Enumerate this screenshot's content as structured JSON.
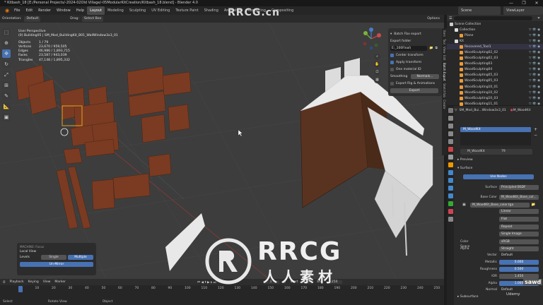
{
  "window": {
    "title": "* Kitbash_18 [E:/Personal Projects/-2024-02Old Village/-05ModularKitCreation/Kitbash_18.blend] - Blender 4.0",
    "controls": [
      "—",
      "❐",
      "✕"
    ]
  },
  "menubar": {
    "items": [
      "File",
      "Edit",
      "Render",
      "Window",
      "Help"
    ],
    "workspaces": [
      "Layout",
      "Modeling",
      "Sculpting",
      "UV Editing",
      "Texture Paint",
      "Shading",
      "Animation",
      "Rendering",
      "Compositing"
    ],
    "active_workspace": "Layout",
    "scene_label": "Scene",
    "viewlayer_label": "ViewLayer"
  },
  "header": {
    "orientation_label": "Orientation:",
    "orientation_value": "Default",
    "mode": "Object Mode",
    "menus": [
      "View",
      "Select",
      "Add",
      "Object"
    ],
    "transform_orientation": "Global",
    "drag_label": "Drag:",
    "drag_value": "Select Box",
    "options": "Options"
  },
  "stats": {
    "view": "User Perspective",
    "context": "(0) Building05 | SM_Mod_BuildingKit_B01_WallWindow3x3_01",
    "rows": [
      {
        "k": "Objects",
        "v": "1 / 79"
      },
      {
        "k": "Vertices",
        "v": "23,670 / 959,505"
      },
      {
        "k": "Edges",
        "v": "46,986 / 1,893,715"
      },
      {
        "k": "Faces",
        "v": "23,587 / 943,039"
      },
      {
        "k": "Triangles",
        "v": "47,148 / 1,895,332"
      }
    ]
  },
  "npanel": {
    "title": "Batch Fbx export",
    "folder_label": "Export folder",
    "folder_value": "E:_100Final\\",
    "center_transform": "Center transform",
    "apply_transform": "Apply transform",
    "one_material": "One material ID",
    "smoothing_label": "Smoothing",
    "smoothing_value": "Normals...",
    "export_rig": "Export Rig & Animations",
    "export_button": "Export",
    "tabs": [
      "Item",
      "Tool",
      "View",
      "Edit",
      "Batch Export",
      "Sketchfab",
      "Create"
    ]
  },
  "popup": {
    "title": "MACHIN3: Focus",
    "mode": "Local View",
    "levels_label": "Levels",
    "single": "Single",
    "multiple": "Multiple",
    "unmirror": "Un-Mirror"
  },
  "timeline": {
    "menus": [
      "Playback",
      "Keying",
      "View",
      "Marker"
    ],
    "current_frame": "1",
    "start_label": "Start",
    "start_value": "1",
    "end_label": "End",
    "end_value": "250",
    "ticks": [
      "0",
      "10",
      "20",
      "30",
      "40",
      "50",
      "60",
      "70",
      "80",
      "90",
      "100",
      "110",
      "120",
      "130",
      "140",
      "150",
      "160",
      "170",
      "180",
      "190",
      "200",
      "210",
      "220",
      "230",
      "240",
      "250"
    ],
    "status_select": "Select",
    "status_rotate": "Rotate View",
    "status_object": "Object"
  },
  "outliner": {
    "search_placeholder": "",
    "rows": [
      {
        "name": "Scene Collection",
        "indent": 0
      },
      {
        "name": "Collection",
        "indent": 1
      },
      {
        "name": "Plane",
        "indent": 2
      },
      {
        "name": "Kit",
        "indent": 1
      },
      {
        "name": "Recovered_Tool1",
        "indent": 2
      },
      {
        "name": "WoodSculpting02_02",
        "indent": 2
      },
      {
        "name": "WoodSculpting02_03",
        "indent": 2
      },
      {
        "name": "WoodSculpting03",
        "indent": 2
      },
      {
        "name": "WoodSculpting04",
        "indent": 2
      },
      {
        "name": "WoodSculpting05_03",
        "indent": 2
      },
      {
        "name": "WoodSculpting05_03",
        "indent": 2
      },
      {
        "name": "WoodSculpting10_01",
        "indent": 2
      },
      {
        "name": "WoodSculpting10_02",
        "indent": 2
      },
      {
        "name": "WoodSculpting10_03",
        "indent": 2
      },
      {
        "name": "WoodSculpting11_01",
        "indent": 2
      }
    ]
  },
  "properties": {
    "object_name": "SM_Mod_Bui...Window3x3_01",
    "slot_name": "M_WoodKit",
    "material_name": "M_WoodKit",
    "user_count": "79",
    "preview": "Preview",
    "surface": "Surface",
    "use_nodes": "Use Nodes",
    "surface_label": "Surface",
    "surface_value": "Principled BSDF",
    "base_color_label": "Base Color",
    "base_color_value": "M_WoodKit_Base_col...",
    "image_name": "M_WoodKit_Base_color.tga",
    "interp": "Linear",
    "projection": "Flat",
    "extension": "Repeat",
    "source": "Single Image",
    "color_space_label": "Color Space",
    "color_space_value": "sRGB",
    "alpha_label": "Alpha",
    "alpha_value": "Straight",
    "vector_label": "Vector",
    "vector_value": "Default",
    "metallic_label": "Metallic",
    "metallic_value": "0.000",
    "roughness_label": "Roughness",
    "roughness_value": "0.500",
    "ior_label": "IOR",
    "ior_value": "1.450",
    "alpha2_label": "Alpha",
    "alpha2_value": "1.000",
    "normal_label": "Normal",
    "normal_value": "Default",
    "subsurface": "Subsurface"
  },
  "watermark": {
    "logo_text": "RRCG",
    "sub_text": "人人素材",
    "top_text": "RRCG.cn",
    "udemy": "Udemy",
    "sawd": "sawd"
  },
  "colors": {
    "accent": "#4772b3",
    "viewport_bg": "#3d3d3d",
    "wood": "#7a3b22",
    "roof": "#e6e6e6"
  }
}
